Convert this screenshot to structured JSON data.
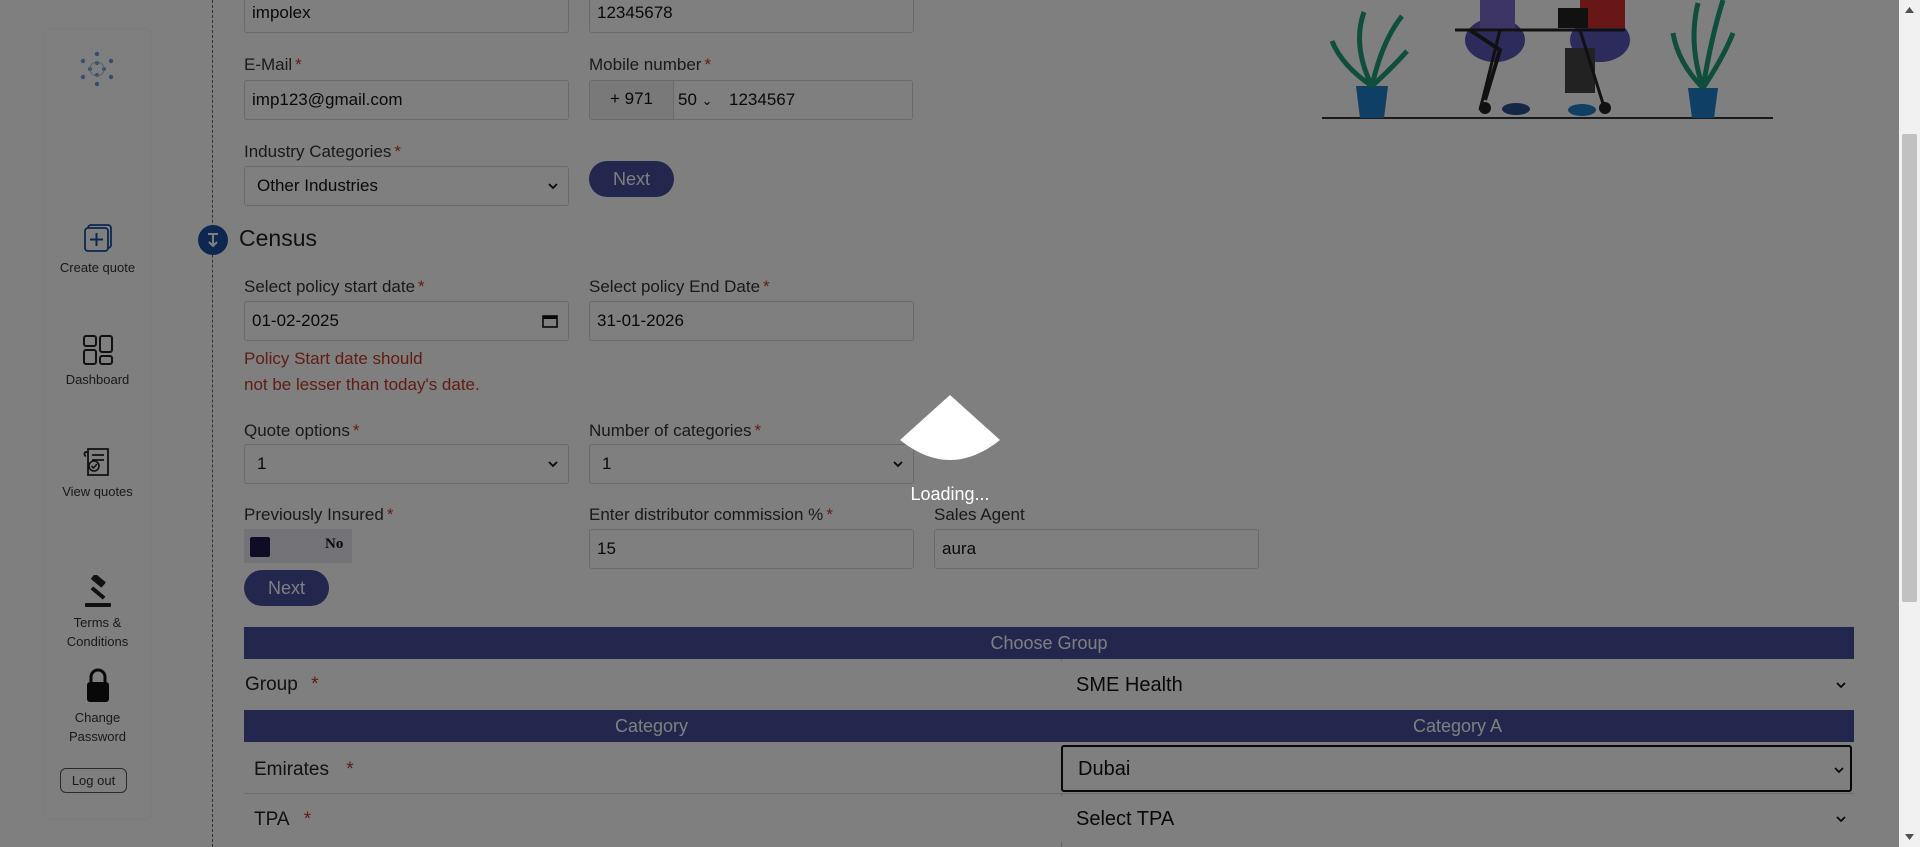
{
  "sidebar": {
    "items": [
      {
        "label": "Create quote",
        "icon": "plus-square-icon"
      },
      {
        "label": "Dashboard",
        "icon": "dashboard-grid-icon"
      },
      {
        "label": "View quotes",
        "icon": "document-check-icon"
      },
      {
        "label": "Terms & Conditions",
        "icon": "gavel-icon"
      },
      {
        "label": "Change Password",
        "icon": "lock-icon"
      }
    ],
    "logout_label": "Log out"
  },
  "company": {
    "name_value": "impolex",
    "trade_license_value": "12345678",
    "email_label": "E-Mail",
    "email_value": "imp123@gmail.com",
    "mobile_label": "Mobile number",
    "country_code": "+ 971",
    "prefix_value": "50",
    "mobile_value": "1234567",
    "industry_label": "Industry Categories",
    "industry_value": "Other Industries",
    "next_label": "Next"
  },
  "census": {
    "title": "Census",
    "start_date_label": "Select policy start date",
    "start_date_value": "01-02-2025",
    "end_date_label": "Select policy End Date",
    "end_date_value": "31-01-2026",
    "error_line1": "Policy Start date should",
    "error_line2": "not be lesser than today's date.",
    "quote_options_label": "Quote options",
    "quote_options_value": "1",
    "num_categories_label": "Number of categories",
    "num_categories_value": "1",
    "previously_insured_label": "Previously Insured",
    "previously_insured_value": "No",
    "commission_label": "Enter distributor commission %",
    "commission_value": "15",
    "sales_agent_label": "Sales Agent",
    "sales_agent_value": "aura",
    "next_label": "Next"
  },
  "group_table": {
    "header": "Choose Group",
    "group_label": "Group",
    "group_value": "SME Health",
    "category_header": "Category",
    "category_a_header": "Category A",
    "emirates_label": "Emirates",
    "emirates_value": "Dubai",
    "tpa_label": "TPA",
    "tpa_value": "Select TPA"
  },
  "required_mark": "*",
  "overlay": {
    "loading_text": "Loading..."
  },
  "colors": {
    "accent": "#474e9c",
    "error": "#c0392b",
    "census_icon": "#1a4fa0"
  }
}
